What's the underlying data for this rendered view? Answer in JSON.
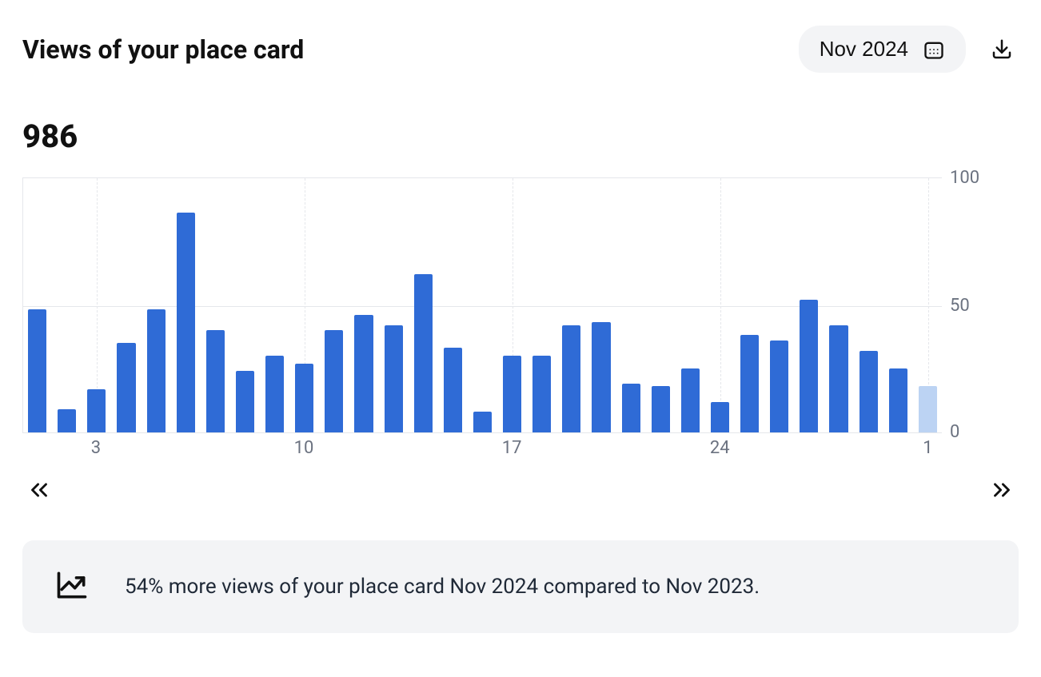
{
  "header": {
    "title": "Views of your place card",
    "period_label": "Nov 2024"
  },
  "total": "986",
  "chart_data": {
    "type": "bar",
    "categories": [
      "1",
      "2",
      "3",
      "4",
      "5",
      "6",
      "7",
      "8",
      "9",
      "10",
      "11",
      "12",
      "13",
      "14",
      "15",
      "16",
      "17",
      "18",
      "19",
      "20",
      "21",
      "22",
      "23",
      "24",
      "25",
      "26",
      "27",
      "28",
      "29",
      "30",
      "1"
    ],
    "values": [
      48,
      9,
      17,
      35,
      48,
      86,
      40,
      24,
      30,
      27,
      40,
      46,
      42,
      62,
      33,
      8,
      30,
      30,
      42,
      43,
      19,
      18,
      25,
      12,
      38,
      36,
      52,
      42,
      32,
      25,
      18
    ],
    "dim_indices": [
      30
    ],
    "ylabel": "",
    "xlabel": "",
    "title": "",
    "ylim": [
      0,
      100
    ],
    "y_ticks": [
      0,
      50,
      100
    ],
    "x_tick_labels": [
      {
        "index": 2,
        "label": "3"
      },
      {
        "index": 9,
        "label": "10"
      },
      {
        "index": 16,
        "label": "17"
      },
      {
        "index": 23,
        "label": "24"
      },
      {
        "index": 30,
        "label": "1"
      }
    ],
    "grid_v_indices": [
      2,
      9,
      16,
      23,
      30
    ]
  },
  "y_axis": {
    "t0": "0",
    "t50": "50",
    "t100": "100"
  },
  "x_axis": {
    "t3": "3",
    "t10": "10",
    "t17": "17",
    "t24": "24",
    "t1": "1"
  },
  "insight": {
    "text": "54% more views of your place card Nov 2024 compared to Nov 2023."
  }
}
